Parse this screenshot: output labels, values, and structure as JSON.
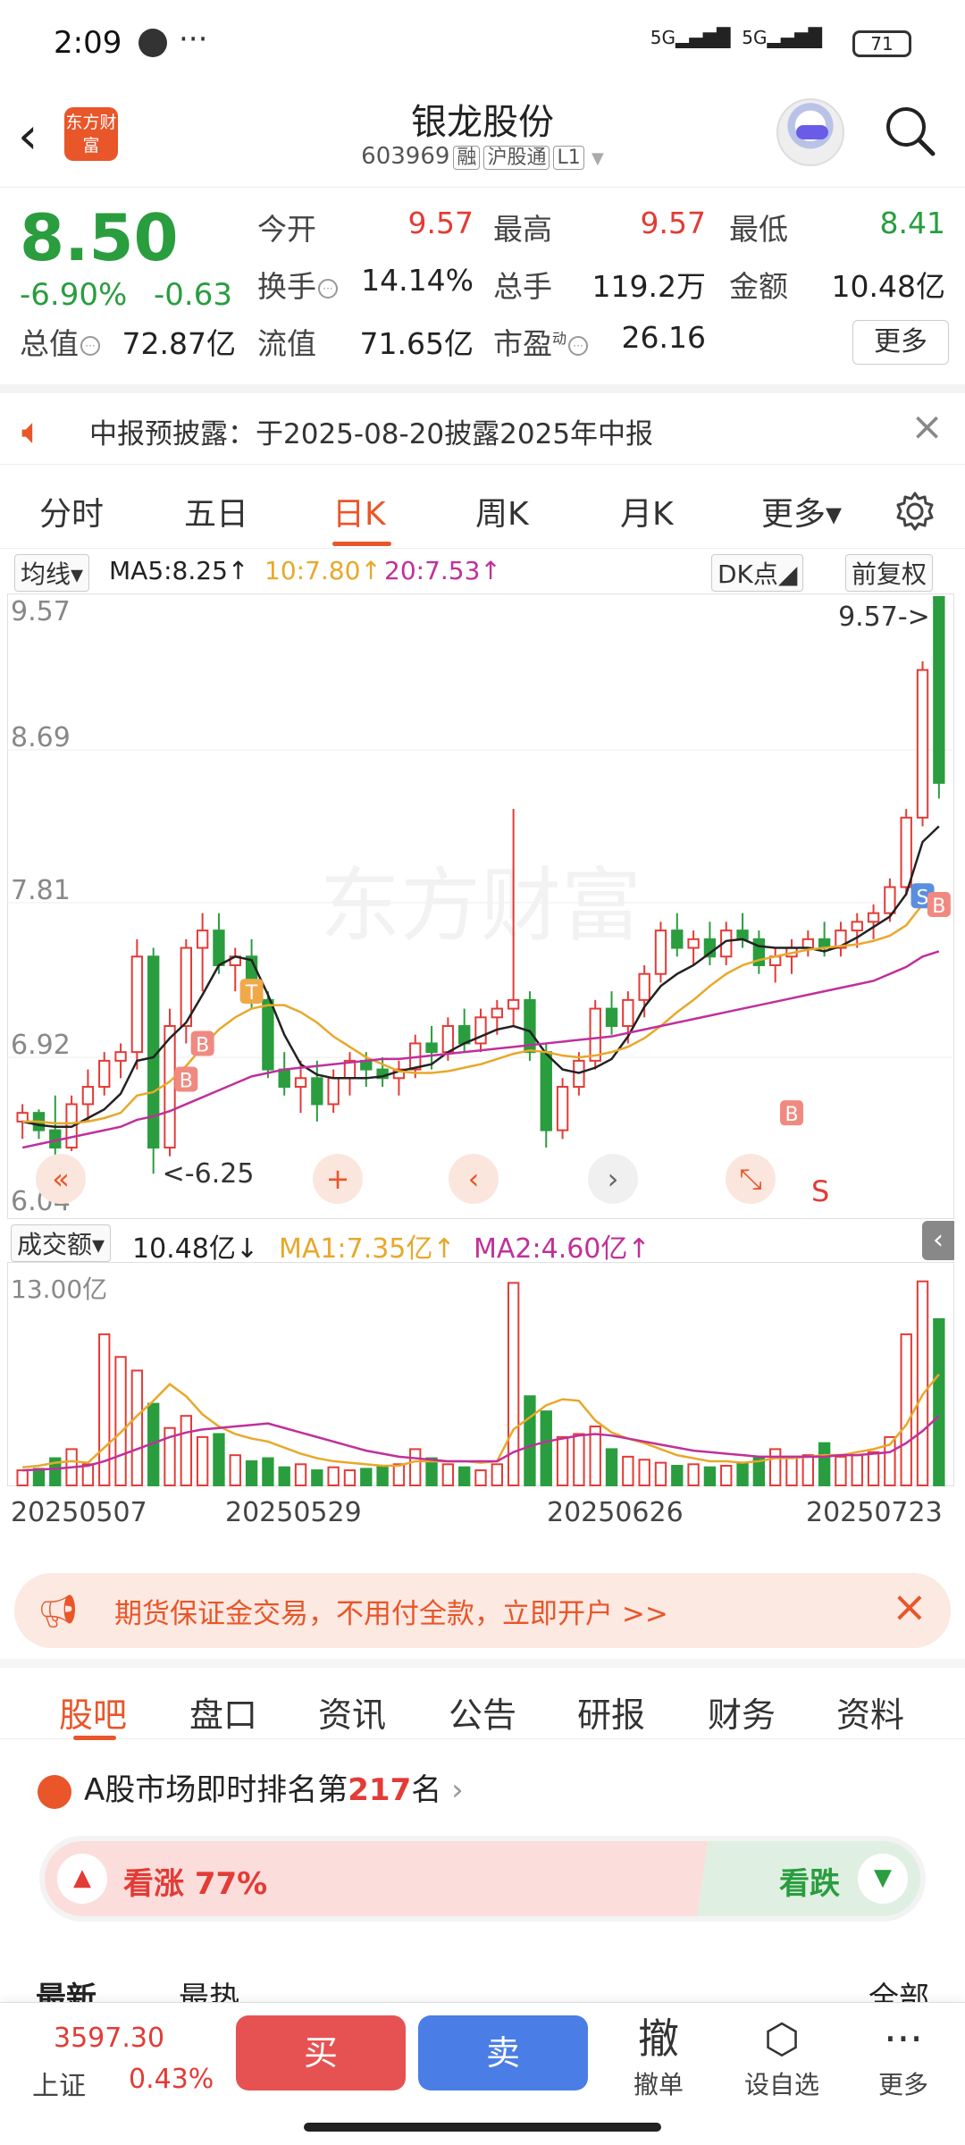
{
  "status_bar": {
    "time": "2:09",
    "dots": "···",
    "signal1": "5G",
    "signal2": "5G",
    "battery": "71"
  },
  "header": {
    "logo_text": "东方财富",
    "stock_name": "银龙股份",
    "stock_code": "603969",
    "tags": [
      "融",
      "沪股通",
      "L1"
    ]
  },
  "quote": {
    "price": "8.50",
    "pct": "-6.90%",
    "change": "-0.63",
    "labels": {
      "open": "今开",
      "high": "最高",
      "low": "最低",
      "turnover_rate": "换手",
      "volume": "总手",
      "amount": "金额",
      "mkt_cap": "总值",
      "float_cap": "流值",
      "pe": "市盈",
      "pe_sup": "动"
    },
    "values": {
      "open": "9.57",
      "high": "9.57",
      "low": "8.41",
      "turnover_rate": "14.14%",
      "volume": "119.2万",
      "amount": "10.48亿",
      "mkt_cap": "72.87亿",
      "float_cap": "71.65亿",
      "pe": "26.16"
    },
    "more_label": "更多"
  },
  "notice": {
    "text": "中报预披露：于2025-08-20披露2025年中报"
  },
  "period_tabs": {
    "items": [
      "分时",
      "五日",
      "日K",
      "周K",
      "月K",
      "更多▾"
    ],
    "active_index": 2
  },
  "ma_bar": {
    "selector": "均线▾",
    "ma5": "MA5:8.25↑",
    "ma10": "10:7.80↑",
    "ma20": "20:7.53↑",
    "dk": "DK点◢",
    "adjust": "前复权",
    "colors": {
      "ma5": "#222222",
      "ma10": "#e8a82a",
      "ma20": "#c0309a"
    }
  },
  "chart_data": [
    {
      "type": "candlestick",
      "y_ticks": [
        "9.57",
        "8.69",
        "7.81",
        "6.92",
        "6.04"
      ],
      "ylim": [
        6.04,
        9.57
      ],
      "high_label": "9.57->",
      "low_label": "<-6.25",
      "signal_labels": [
        "B",
        "T",
        "S"
      ],
      "s_label": "S",
      "watermark": "东方财富",
      "up_color": "#e33b36",
      "down_color": "#2a9d3f",
      "candles": [
        [
          6.55,
          6.65,
          6.45,
          6.6
        ],
        [
          6.6,
          6.62,
          6.45,
          6.5
        ],
        [
          6.5,
          6.7,
          6.35,
          6.4
        ],
        [
          6.4,
          6.7,
          6.38,
          6.65
        ],
        [
          6.65,
          6.85,
          6.55,
          6.75
        ],
        [
          6.75,
          6.95,
          6.7,
          6.9
        ],
        [
          6.9,
          7.0,
          6.8,
          6.95
        ],
        [
          6.95,
          7.6,
          6.85,
          7.5
        ],
        [
          7.5,
          7.55,
          6.25,
          6.4
        ],
        [
          6.4,
          7.2,
          6.35,
          7.1
        ],
        [
          7.1,
          7.6,
          7.0,
          7.55
        ],
        [
          7.55,
          7.75,
          7.3,
          7.65
        ],
        [
          7.65,
          7.75,
          7.4,
          7.45
        ],
        [
          7.45,
          7.55,
          7.3,
          7.5
        ],
        [
          7.5,
          7.6,
          7.2,
          7.25
        ],
        [
          7.25,
          7.3,
          6.8,
          6.85
        ],
        [
          6.85,
          6.95,
          6.7,
          6.75
        ],
        [
          6.75,
          6.9,
          6.6,
          6.8
        ],
        [
          6.8,
          6.9,
          6.55,
          6.65
        ],
        [
          6.65,
          6.85,
          6.6,
          6.8
        ],
        [
          6.8,
          6.95,
          6.7,
          6.9
        ],
        [
          6.9,
          6.95,
          6.75,
          6.85
        ],
        [
          6.85,
          6.92,
          6.75,
          6.8
        ],
        [
          6.8,
          6.9,
          6.7,
          6.85
        ],
        [
          6.85,
          7.05,
          6.8,
          7.0
        ],
        [
          7.0,
          7.1,
          6.85,
          6.95
        ],
        [
          6.95,
          7.15,
          6.9,
          7.1
        ],
        [
          7.1,
          7.2,
          6.95,
          7.0
        ],
        [
          7.0,
          7.2,
          6.95,
          7.15
        ],
        [
          7.15,
          7.25,
          7.05,
          7.2
        ],
        [
          7.2,
          8.35,
          7.1,
          7.25
        ],
        [
          7.25,
          7.3,
          6.9,
          6.95
        ],
        [
          6.95,
          7.0,
          6.4,
          6.5
        ],
        [
          6.5,
          6.8,
          6.45,
          6.75
        ],
        [
          6.75,
          6.95,
          6.7,
          6.9
        ],
        [
          6.9,
          7.25,
          6.85,
          7.2
        ],
        [
          7.2,
          7.3,
          7.05,
          7.1
        ],
        [
          7.1,
          7.3,
          7.0,
          7.25
        ],
        [
          7.25,
          7.45,
          7.15,
          7.4
        ],
        [
          7.4,
          7.7,
          7.35,
          7.65
        ],
        [
          7.65,
          7.75,
          7.5,
          7.55
        ],
        [
          7.55,
          7.65,
          7.45,
          7.6
        ],
        [
          7.6,
          7.7,
          7.45,
          7.5
        ],
        [
          7.5,
          7.7,
          7.45,
          7.65
        ],
        [
          7.65,
          7.75,
          7.55,
          7.6
        ],
        [
          7.6,
          7.65,
          7.4,
          7.45
        ],
        [
          7.45,
          7.55,
          7.35,
          7.5
        ],
        [
          7.5,
          7.6,
          7.4,
          7.55
        ],
        [
          7.55,
          7.65,
          7.5,
          7.6
        ],
        [
          7.6,
          7.7,
          7.5,
          7.55
        ],
        [
          7.55,
          7.7,
          7.5,
          7.65
        ],
        [
          7.65,
          7.75,
          7.55,
          7.7
        ],
        [
          7.7,
          7.8,
          7.6,
          7.75
        ],
        [
          7.75,
          7.95,
          7.7,
          7.9
        ],
        [
          7.9,
          8.35,
          7.85,
          8.3
        ],
        [
          8.3,
          9.2,
          8.25,
          9.15
        ],
        [
          9.57,
          9.57,
          8.41,
          8.5
        ]
      ],
      "ma5": [
        6.55,
        6.53,
        6.52,
        6.52,
        6.57,
        6.62,
        6.71,
        6.9,
        6.92,
        7.03,
        7.12,
        7.28,
        7.45,
        7.5,
        7.48,
        7.28,
        7.05,
        6.88,
        6.82,
        6.8,
        6.8,
        6.8,
        6.81,
        6.84,
        6.86,
        6.88,
        6.95,
        7.0,
        7.04,
        7.08,
        7.1,
        7.07,
        6.94,
        6.85,
        6.83,
        6.86,
        6.91,
        7.04,
        7.21,
        7.33,
        7.4,
        7.45,
        7.52,
        7.59,
        7.6,
        7.56,
        7.55,
        7.55,
        7.55,
        7.53,
        7.56,
        7.61,
        7.67,
        7.73,
        7.86,
        8.16,
        8.25
      ],
      "ma10": [
        6.55,
        6.55,
        6.54,
        6.54,
        6.55,
        6.57,
        6.6,
        6.7,
        6.72,
        6.78,
        6.87,
        6.98,
        7.08,
        7.15,
        7.2,
        7.22,
        7.22,
        7.18,
        7.12,
        7.04,
        6.98,
        6.92,
        6.88,
        6.84,
        6.83,
        6.83,
        6.84,
        6.86,
        6.88,
        6.91,
        6.94,
        6.96,
        6.95,
        6.93,
        6.92,
        6.93,
        6.95,
        6.98,
        7.03,
        7.1,
        7.18,
        7.25,
        7.33,
        7.4,
        7.45,
        7.48,
        7.5,
        7.52,
        7.54,
        7.55,
        7.56,
        7.57,
        7.59,
        7.62,
        7.68,
        7.8,
        7.8
      ],
      "ma20": [
        6.4,
        6.42,
        6.44,
        6.46,
        6.48,
        6.5,
        6.52,
        6.56,
        6.58,
        6.61,
        6.65,
        6.69,
        6.73,
        6.77,
        6.81,
        6.83,
        6.85,
        6.86,
        6.87,
        6.88,
        6.89,
        6.9,
        6.91,
        6.91,
        6.92,
        6.93,
        6.94,
        6.95,
        6.96,
        6.97,
        6.98,
        6.99,
        7.0,
        7.01,
        7.02,
        7.03,
        7.04,
        7.06,
        7.08,
        7.1,
        7.12,
        7.14,
        7.16,
        7.18,
        7.2,
        7.22,
        7.24,
        7.26,
        7.28,
        7.3,
        7.32,
        7.34,
        7.36,
        7.4,
        7.44,
        7.5,
        7.53
      ]
    },
    {
      "type": "bar",
      "title": "成交额",
      "y_ticks": [
        "13.00亿"
      ],
      "ylim": [
        0,
        13.0
      ],
      "dates": [
        "20250507",
        "20250529",
        "20250626",
        "20250723"
      ],
      "values": [
        1.0,
        1.1,
        1.8,
        2.4,
        1.4,
        10.0,
        8.5,
        7.6,
        5.4,
        3.8,
        4.6,
        3.2,
        3.4,
        2.0,
        1.6,
        1.8,
        1.2,
        1.4,
        1.0,
        1.2,
        1.0,
        1.1,
        1.3,
        1.4,
        2.4,
        1.8,
        1.4,
        1.2,
        1.0,
        1.4,
        13.4,
        5.9,
        4.9,
        3.2,
        3.4,
        3.9,
        2.4,
        1.9,
        1.7,
        1.5,
        1.3,
        1.4,
        1.2,
        1.3,
        1.5,
        1.8,
        2.4,
        1.9,
        2.0,
        2.8,
        1.9,
        2.0,
        2.2,
        3.2,
        10.0,
        13.5,
        11.0
      ],
      "ma1": [
        1.2,
        1.3,
        1.5,
        1.6,
        1.5,
        2.5,
        3.5,
        4.6,
        5.6,
        6.7,
        5.9,
        4.7,
        3.9,
        3.4,
        3.1,
        2.9,
        2.5,
        2.1,
        1.8,
        1.6,
        1.5,
        1.4,
        1.3,
        1.3,
        1.6,
        1.6,
        1.6,
        1.6,
        1.5,
        1.6,
        3.7,
        4.5,
        5.3,
        5.7,
        5.6,
        4.3,
        3.5,
        3.1,
        2.8,
        2.4,
        2.0,
        1.8,
        1.6,
        1.6,
        1.5,
        1.6,
        1.8,
        1.8,
        1.9,
        2.0,
        2.0,
        2.2,
        2.4,
        2.7,
        4.0,
        6.0,
        7.35
      ],
      "ma2": [
        1.0,
        1.05,
        1.1,
        1.2,
        1.3,
        1.6,
        2.0,
        2.4,
        2.8,
        3.2,
        3.5,
        3.7,
        3.8,
        3.9,
        4.0,
        4.1,
        3.8,
        3.5,
        3.2,
        2.9,
        2.6,
        2.3,
        2.1,
        1.9,
        1.8,
        1.7,
        1.6,
        1.6,
        1.6,
        1.6,
        2.2,
        2.6,
        2.9,
        3.1,
        3.3,
        3.4,
        3.3,
        3.1,
        2.9,
        2.7,
        2.5,
        2.3,
        2.2,
        2.1,
        2.0,
        1.9,
        1.9,
        1.9,
        1.9,
        1.9,
        2.0,
        2.0,
        2.1,
        2.2,
        2.8,
        3.6,
        4.6
      ]
    }
  ],
  "vol_bar": {
    "selector": "成交额▾",
    "amount": "10.48亿↓",
    "ma1": "MA1:7.35亿↑",
    "ma2": "MA2:4.60亿↑"
  },
  "ad_banner": {
    "text": "期货保证金交易，不用付全款，立即开户 >>"
  },
  "content_tabs": {
    "items": [
      "股吧",
      "盘口",
      "资讯",
      "公告",
      "研报",
      "财务",
      "资料"
    ],
    "active_index": 0
  },
  "rank": {
    "prefix": "A股市场即时排名第",
    "number": "217",
    "suffix": "名"
  },
  "sentiment": {
    "up_label": "看涨 77%",
    "down_label": "看跌"
  },
  "sub_tabs": {
    "latest": "最新",
    "hot": "最热",
    "all": "全部"
  },
  "bottom_bar": {
    "index_value": "3597.30",
    "index_name": "上证",
    "index_pct": "0.43%",
    "buy": "买",
    "sell": "卖",
    "cancel_big": "撤",
    "cancel_label": "撤单",
    "watch_label": "设自选",
    "more_label": "更多"
  }
}
